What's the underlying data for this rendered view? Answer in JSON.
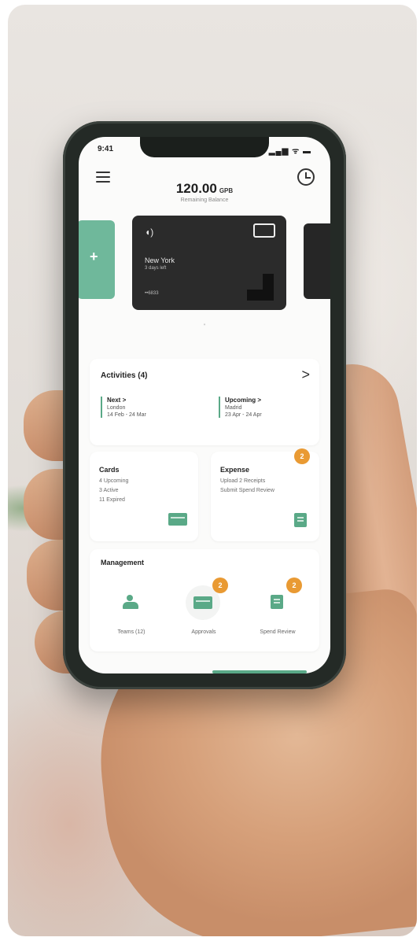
{
  "status_bar": {
    "time": "9:41",
    "signal": "▂▄▆ ᯤ ▬"
  },
  "header": {
    "balance_amount": "120.00",
    "balance_currency": "GPB",
    "balance_caption": "Remaining Balance"
  },
  "cards_carousel": {
    "add_label": "+",
    "main_card": {
      "city": "New York",
      "days_left": "3 days left",
      "number": "••6833"
    },
    "pager": "•"
  },
  "activities": {
    "title": "Activities (4)",
    "chevron": ">",
    "next": {
      "heading": "Next >",
      "place": "London",
      "dates": "14 Feb - 24 Mar"
    },
    "upcoming": {
      "heading": "Upcoming >",
      "place": "Madrid",
      "dates": "23 Apr - 24 Apr"
    }
  },
  "cards_summary": {
    "title": "Cards",
    "line1": "4 Upcoming",
    "line2": "3 Active",
    "line3": "11 Expired"
  },
  "expense": {
    "title": "Expense",
    "badge": "2",
    "line1": "Upload 2 Receipts",
    "line2": "Submit Spend Review"
  },
  "management": {
    "title": "Management",
    "items": [
      {
        "label": "Teams (12)",
        "badge": ""
      },
      {
        "label": "Approvals",
        "badge": "2"
      },
      {
        "label": "Spend Review",
        "badge": "2"
      }
    ]
  },
  "colors": {
    "accent_green": "#5aa987",
    "badge_orange": "#e99a33",
    "card_dark": "#2b2b2b"
  }
}
